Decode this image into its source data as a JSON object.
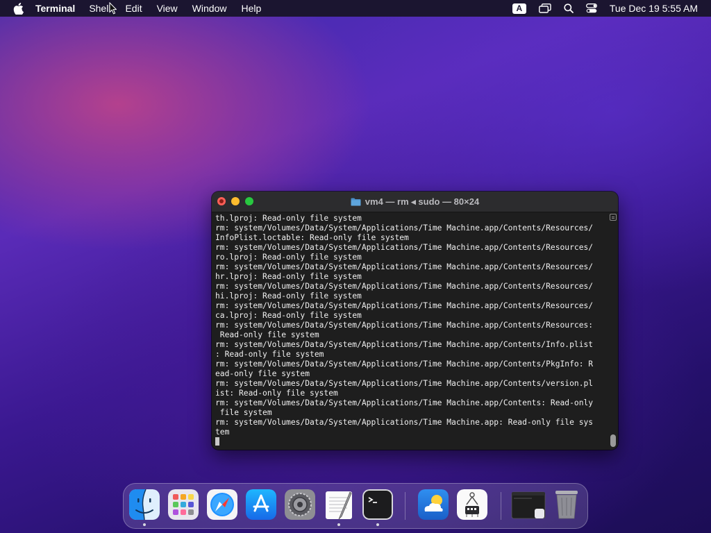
{
  "menubar": {
    "app_name": "Terminal",
    "items": [
      "Shell",
      "Edit",
      "View",
      "Window",
      "Help"
    ],
    "input_source": "A",
    "clock": "Tue Dec 19  5:55 AM"
  },
  "terminal": {
    "title": "vm4 — rm ◂ sudo — 80×24",
    "lines": [
      "th.lproj: Read-only file system",
      "rm: system/Volumes/Data/System/Applications/Time Machine.app/Contents/Resources/",
      "InfoPlist.loctable: Read-only file system",
      "rm: system/Volumes/Data/System/Applications/Time Machine.app/Contents/Resources/",
      "ro.lproj: Read-only file system",
      "rm: system/Volumes/Data/System/Applications/Time Machine.app/Contents/Resources/",
      "hr.lproj: Read-only file system",
      "rm: system/Volumes/Data/System/Applications/Time Machine.app/Contents/Resources/",
      "hi.lproj: Read-only file system",
      "rm: system/Volumes/Data/System/Applications/Time Machine.app/Contents/Resources/",
      "ca.lproj: Read-only file system",
      "rm: system/Volumes/Data/System/Applications/Time Machine.app/Contents/Resources:",
      " Read-only file system",
      "rm: system/Volumes/Data/System/Applications/Time Machine.app/Contents/Info.plist",
      ": Read-only file system",
      "rm: system/Volumes/Data/System/Applications/Time Machine.app/Contents/PkgInfo: R",
      "ead-only file system",
      "rm: system/Volumes/Data/System/Applications/Time Machine.app/Contents/version.pl",
      "ist: Read-only file system",
      "rm: system/Volumes/Data/System/Applications/Time Machine.app/Contents: Read-only",
      " file system",
      "rm: system/Volumes/Data/System/Applications/Time Machine.app: Read-only file sys",
      "tem"
    ]
  },
  "colors": {
    "close": "#ff5f57",
    "minimize": "#febc2e",
    "maximize": "#28c840",
    "terminal_bg": "#1e1e1e"
  },
  "dock": {
    "icons": [
      "finder-icon",
      "launchpad-icon",
      "safari-icon",
      "app-store-icon",
      "system-settings-icon",
      "textedit-icon",
      "terminal-icon",
      "weather-icon",
      "system-information-icon",
      "minimized-window-icon",
      "trash-icon"
    ]
  }
}
